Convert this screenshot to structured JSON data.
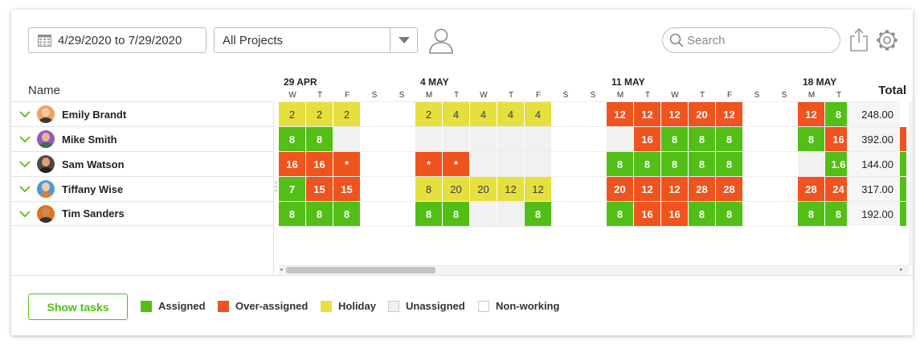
{
  "toolbar": {
    "date_range": "4/29/2020 to 7/29/2020",
    "project_filter": "All Projects",
    "search_placeholder": "Search"
  },
  "grid": {
    "name_header": "Name",
    "total_header": "Total",
    "weeks": [
      "29 APR",
      "4 MAY",
      "11 MAY",
      "18 MAY"
    ],
    "day_letters": [
      "W",
      "T",
      "F",
      "S",
      "S",
      "M",
      "T",
      "W",
      "T",
      "F",
      "S",
      "S",
      "M",
      "T",
      "W",
      "T",
      "F",
      "S",
      "S",
      "M",
      "T"
    ]
  },
  "people": [
    {
      "name": "Emily Brandt",
      "total": "248.00",
      "cells": [
        [
          "h",
          "2"
        ],
        [
          "h",
          "2"
        ],
        [
          "h",
          "2"
        ],
        [
          "",
          ""
        ],
        [
          "",
          ""
        ],
        [
          "h",
          "2"
        ],
        [
          "h",
          "4"
        ],
        [
          "h",
          "4"
        ],
        [
          "h",
          "4"
        ],
        [
          "h",
          "4"
        ],
        [
          "",
          ""
        ],
        [
          "",
          ""
        ],
        [
          "o",
          "12"
        ],
        [
          "o",
          "12"
        ],
        [
          "o",
          "12"
        ],
        [
          "o",
          "20"
        ],
        [
          "o",
          "12"
        ],
        [
          "",
          ""
        ],
        [
          "",
          ""
        ],
        [
          "o",
          "12"
        ],
        [
          "g",
          "8"
        ]
      ]
    },
    {
      "name": "Mike Smith",
      "total": "392.00",
      "cells": [
        [
          "g",
          "8"
        ],
        [
          "g",
          "8"
        ],
        [
          "u",
          ""
        ],
        [
          "",
          ""
        ],
        [
          "",
          ""
        ],
        [
          "u",
          ""
        ],
        [
          "u",
          ""
        ],
        [
          "u",
          ""
        ],
        [
          "u",
          ""
        ],
        [
          "u",
          ""
        ],
        [
          "",
          ""
        ],
        [
          "",
          ""
        ],
        [
          "u",
          ""
        ],
        [
          "o",
          "16"
        ],
        [
          "g",
          "8"
        ],
        [
          "g",
          "8"
        ],
        [
          "g",
          "8"
        ],
        [
          "",
          ""
        ],
        [
          "",
          ""
        ],
        [
          "g",
          "8"
        ],
        [
          "o",
          "16"
        ]
      ]
    },
    {
      "name": "Sam Watson",
      "total": "144.00",
      "cells": [
        [
          "o",
          "16"
        ],
        [
          "o",
          "16"
        ],
        [
          "o",
          "*"
        ],
        [
          "",
          ""
        ],
        [
          "",
          ""
        ],
        [
          "o",
          "*"
        ],
        [
          "o",
          "*"
        ],
        [
          "u",
          ""
        ],
        [
          "u",
          ""
        ],
        [
          "u",
          ""
        ],
        [
          "",
          ""
        ],
        [
          "",
          ""
        ],
        [
          "g",
          "8"
        ],
        [
          "g",
          "8"
        ],
        [
          "g",
          "8"
        ],
        [
          "g",
          "8"
        ],
        [
          "g",
          "8"
        ],
        [
          "",
          ""
        ],
        [
          "",
          ""
        ],
        [
          "u",
          ""
        ],
        [
          "g",
          "1.6"
        ]
      ]
    },
    {
      "name": "Tiffany Wise",
      "total": "317.00",
      "cells": [
        [
          "g",
          "7"
        ],
        [
          "o",
          "15"
        ],
        [
          "o",
          "15"
        ],
        [
          "",
          ""
        ],
        [
          "",
          ""
        ],
        [
          "h",
          "8"
        ],
        [
          "h",
          "20"
        ],
        [
          "h",
          "20"
        ],
        [
          "h",
          "12"
        ],
        [
          "h",
          "12"
        ],
        [
          "",
          ""
        ],
        [
          "",
          ""
        ],
        [
          "o",
          "20"
        ],
        [
          "o",
          "12"
        ],
        [
          "o",
          "12"
        ],
        [
          "o",
          "28"
        ],
        [
          "o",
          "28"
        ],
        [
          "",
          ""
        ],
        [
          "",
          ""
        ],
        [
          "o",
          "28"
        ],
        [
          "o",
          "24"
        ]
      ]
    },
    {
      "name": "Tim Sanders",
      "total": "192.00",
      "cells": [
        [
          "g",
          "8"
        ],
        [
          "g",
          "8"
        ],
        [
          "g",
          "8"
        ],
        [
          "",
          ""
        ],
        [
          "",
          ""
        ],
        [
          "g",
          "8"
        ],
        [
          "g",
          "8"
        ],
        [
          "u",
          ""
        ],
        [
          "u",
          ""
        ],
        [
          "g",
          "8"
        ],
        [
          "",
          ""
        ],
        [
          "",
          ""
        ],
        [
          "g",
          "8"
        ],
        [
          "o",
          "16"
        ],
        [
          "o",
          "16"
        ],
        [
          "g",
          "8"
        ],
        [
          "g",
          "8"
        ],
        [
          "",
          ""
        ],
        [
          "",
          ""
        ],
        [
          "g",
          "8"
        ],
        [
          "g",
          "8"
        ]
      ]
    }
  ],
  "edge_colors": [
    "",
    "#f0531d",
    "#52be16",
    "#52be16",
    "#52be16"
  ],
  "footer": {
    "show_tasks_label": "Show tasks",
    "legend": [
      {
        "label": "Assigned",
        "color": "#52be16"
      },
      {
        "label": "Over-assigned",
        "color": "#f0531d"
      },
      {
        "label": "Holiday",
        "color": "#e5e03e"
      },
      {
        "label": "Unassigned",
        "color": "#f1f1f1"
      },
      {
        "label": "Non-working",
        "color": "#ffffff"
      }
    ]
  },
  "colors": {
    "assigned": "#52be16",
    "over_assigned": "#f0531d",
    "holiday": "#e5e03e",
    "unassigned": "#f1f1f1",
    "accent": "#52be16"
  }
}
